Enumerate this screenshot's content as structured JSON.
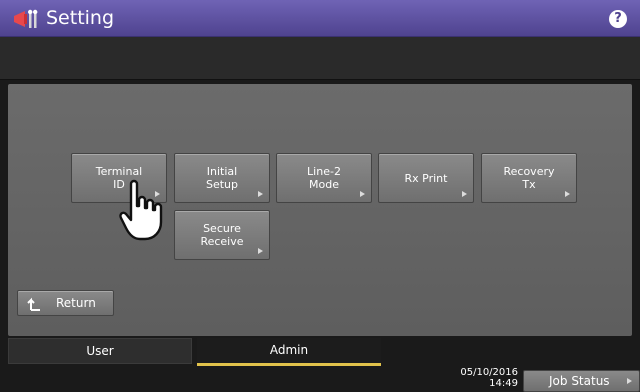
{
  "header": {
    "title": "Setting",
    "help_label": "?"
  },
  "buttons": {
    "terminal_id": "Terminal\nID",
    "initial_setup": "Initial\nSetup",
    "line2_mode": "Line-2\nMode",
    "rx_print": "Rx Print",
    "recovery_tx": "Recovery\nTx",
    "secure_receive": "Secure\nReceive",
    "return": "Return"
  },
  "tabs": {
    "user": "User",
    "admin": "Admin",
    "active": "Admin"
  },
  "status": {
    "date": "05/10/2016",
    "time": "14:49",
    "job_status": "Job Status"
  },
  "colors": {
    "title_bar": "#5a4ea0",
    "active_tab_underline": "#e1c24b",
    "button_face": "#7c7c7c"
  }
}
